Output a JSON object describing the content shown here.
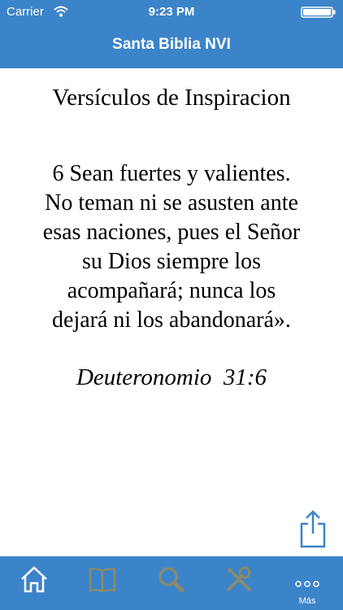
{
  "status_bar": {
    "carrier": "Carrier",
    "time": "9:23 PM"
  },
  "nav_bar": {
    "title": "Santa Biblia NVI"
  },
  "content": {
    "heading": "Versículos de Inspiracion",
    "verse_lines": [
      "6 Sean fuertes y valientes.",
      "No teman ni se asusten ante",
      "esas naciones, pues el Señor",
      "su Dios siempre los",
      "acompañará; nunca los",
      "dejará ni los abandonará»."
    ],
    "reference": "Deuteronomio  31:6"
  },
  "tab_bar": {
    "tabs": [
      {
        "icon": "home-icon",
        "label": ""
      },
      {
        "icon": "book-icon",
        "label": ""
      },
      {
        "icon": "search-icon",
        "label": ""
      },
      {
        "icon": "tools-icon",
        "label": ""
      },
      {
        "icon": "more-icon",
        "label": "Más"
      }
    ]
  },
  "colors": {
    "bar": "#3c84c9",
    "icon_active": "#ffffff",
    "icon_inactive": "#8a8a6e"
  }
}
